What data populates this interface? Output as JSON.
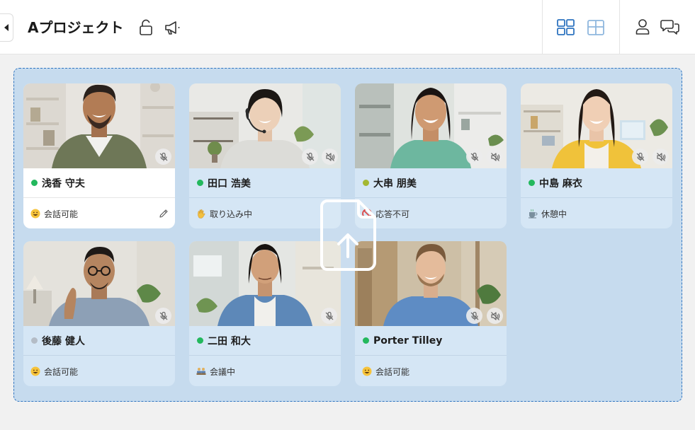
{
  "header": {
    "project_title": "Aプロジェクト"
  },
  "colors": {
    "accent": "#2f74c0",
    "dropzone_bg": "#c6dbee",
    "card_bg": "#d5e6f5",
    "status_online": "#23b85d",
    "status_away": "#a4b832",
    "status_offline": "#b4bcc6"
  },
  "members": [
    {
      "name": "浅香 守夫",
      "status": "会話可能",
      "status_icon": "grinning-face-icon",
      "presence": "online",
      "active": true,
      "mic_muted": true,
      "speaker_muted": false
    },
    {
      "name": "田口 浩美",
      "status": "取り込み中",
      "status_icon": "raised-hand-icon",
      "presence": "online",
      "active": false,
      "mic_muted": true,
      "speaker_muted": true
    },
    {
      "name": "大串 朋美",
      "status": "応答不可",
      "status_icon": "no-entry-icon",
      "presence": "away",
      "active": false,
      "mic_muted": true,
      "speaker_muted": true
    },
    {
      "name": "中島 麻衣",
      "status": "休憩中",
      "status_icon": "coffee-icon",
      "presence": "online",
      "active": false,
      "mic_muted": true,
      "speaker_muted": true
    },
    {
      "name": "後藤 健人",
      "status": "会話可能",
      "status_icon": "grinning-face-icon",
      "presence": "offline",
      "active": false,
      "mic_muted": true,
      "speaker_muted": false
    },
    {
      "name": "二田 和大",
      "status": "会議中",
      "status_icon": "meeting-icon",
      "presence": "online",
      "active": false,
      "mic_muted": true,
      "speaker_muted": false
    },
    {
      "name": "Porter Tilley",
      "status": "会話可能",
      "status_icon": "grinning-face-icon",
      "presence": "online",
      "active": false,
      "mic_muted": true,
      "speaker_muted": true
    }
  ]
}
